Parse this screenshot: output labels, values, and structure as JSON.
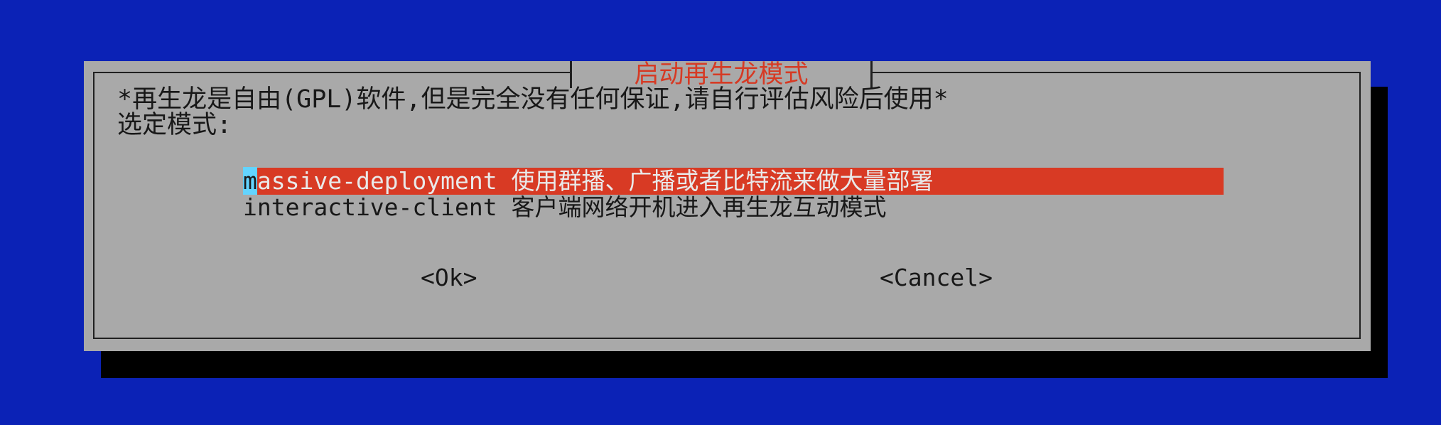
{
  "dialog": {
    "title": "启动再生龙模式",
    "warning": "*再生龙是自由(GPL)软件,但是完全没有任何保证,请自行评估风险后使用*",
    "prompt": "选定模式:",
    "items": [
      {
        "cursor_char": "m",
        "rest": "assive-deployment 使用群播、广播或者比特流来做大量部署"
      },
      {
        "label": "interactive-client 客户端网络开机进入再生龙互动模式"
      }
    ],
    "ok_label": "<Ok>",
    "cancel_label": "<Cancel>"
  },
  "colors": {
    "background": "#0b22b6",
    "dialog": "#a9a9a9",
    "accent": "#d83a24",
    "cursor": "#63d4ff"
  }
}
